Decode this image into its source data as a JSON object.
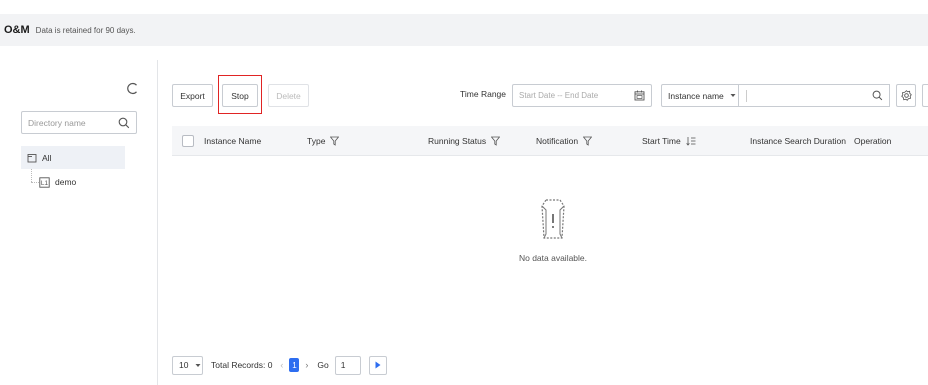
{
  "header": {
    "title": "O&M",
    "note": "Data is retained for 90 days."
  },
  "sidebar": {
    "search_placeholder": "Directory name",
    "tree": {
      "root_label": "All",
      "child_label": "demo"
    }
  },
  "toolbar": {
    "export_label": "Export",
    "stop_label": "Stop",
    "delete_label": "Delete",
    "time_range_label": "Time Range",
    "date_range_placeholder": "Start Date -- End Date",
    "instance_filter_value": "Instance name",
    "search_value": ""
  },
  "table": {
    "columns": [
      "Instance Name",
      "Type",
      "Running Status",
      "Notification",
      "Start Time",
      "Instance Search Duration",
      "Operation"
    ],
    "empty_text": "No data available."
  },
  "pagination": {
    "page_size": "10",
    "total_records": "Total Records: 0",
    "current_page": "1",
    "go_label": "Go",
    "go_value": "1"
  },
  "colors": {
    "accent": "#2d6df0",
    "highlight": "#e02424"
  }
}
